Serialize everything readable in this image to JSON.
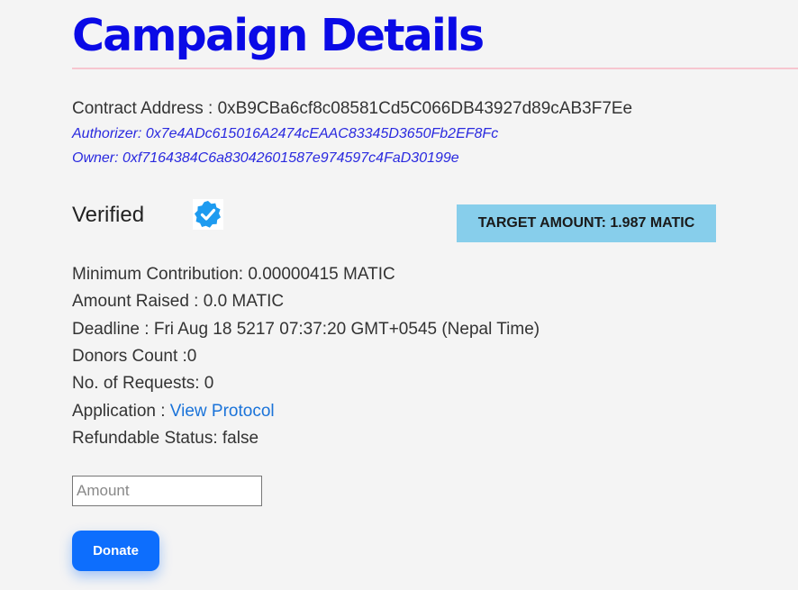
{
  "page": {
    "title": "Campaign Details"
  },
  "contract": {
    "label": "Contract Address : ",
    "address": "0xB9CBa6cf8c08581Cd5C066DB43927d89cAB3F7Ee",
    "authorizer_label": "Authorizer: ",
    "authorizer": "0x7e4ADc615016A2474cEAAC83345D3650Fb2EF8Fc",
    "owner_label": "Owner: ",
    "owner": "0xf7164384C6a83042601587e974597c4FaD30199e"
  },
  "status": {
    "verified_label": "Verified",
    "verified_icon": "verified-badge-icon",
    "verified_icon_color": "#1d9bf0"
  },
  "target": {
    "label": "TARGET AMOUNT: 1.987 MATIC",
    "background": "#87ceeb"
  },
  "details": {
    "min_contribution": "Minimum Contribution: 0.00000415 MATIC",
    "amount_raised": "Amount Raised : 0.0 MATIC",
    "deadline": "Deadline : Fri Aug 18 5217 07:37:20 GMT+0545 (Nepal Time)",
    "donors_count": "Donors Count :0",
    "requests": "No. of Requests: 0",
    "application_label": "Application : ",
    "application_link": "View Protocol",
    "refundable": "Refundable Status: false"
  },
  "form": {
    "amount_placeholder": "Amount",
    "amount_value": "",
    "donate_label": "Donate"
  },
  "colors": {
    "title": "#0a0ae6",
    "italic_addresses": "#2a2adf",
    "link": "#1a73d9",
    "button": "#0d6efd",
    "divider": "#f7c6d0"
  }
}
